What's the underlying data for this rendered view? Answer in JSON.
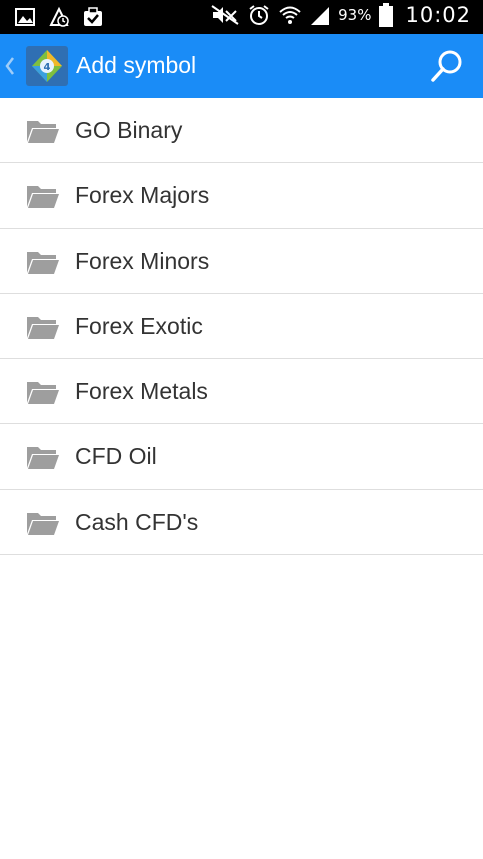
{
  "status_bar": {
    "left_icons": [
      "image-icon",
      "app-update-icon",
      "download-done-icon"
    ],
    "right_icons": [
      "mute-icon",
      "alarm-icon",
      "wifi-icon",
      "signal-icon",
      "battery-icon"
    ],
    "battery_percent": "93%",
    "time": "10:02"
  },
  "action_bar": {
    "title": "Add symbol",
    "app_icon": "metatrader-app-icon",
    "accent_color": "#1a8cf7"
  },
  "list": {
    "items": [
      {
        "label": "GO Binary",
        "icon": "folder-icon"
      },
      {
        "label": "Forex Majors",
        "icon": "folder-icon"
      },
      {
        "label": "Forex Minors",
        "icon": "folder-icon"
      },
      {
        "label": "Forex Exotic",
        "icon": "folder-icon"
      },
      {
        "label": "Forex Metals",
        "icon": "folder-icon"
      },
      {
        "label": "CFD Oil",
        "icon": "folder-icon"
      },
      {
        "label": "Cash CFD's",
        "icon": "folder-icon"
      }
    ]
  }
}
